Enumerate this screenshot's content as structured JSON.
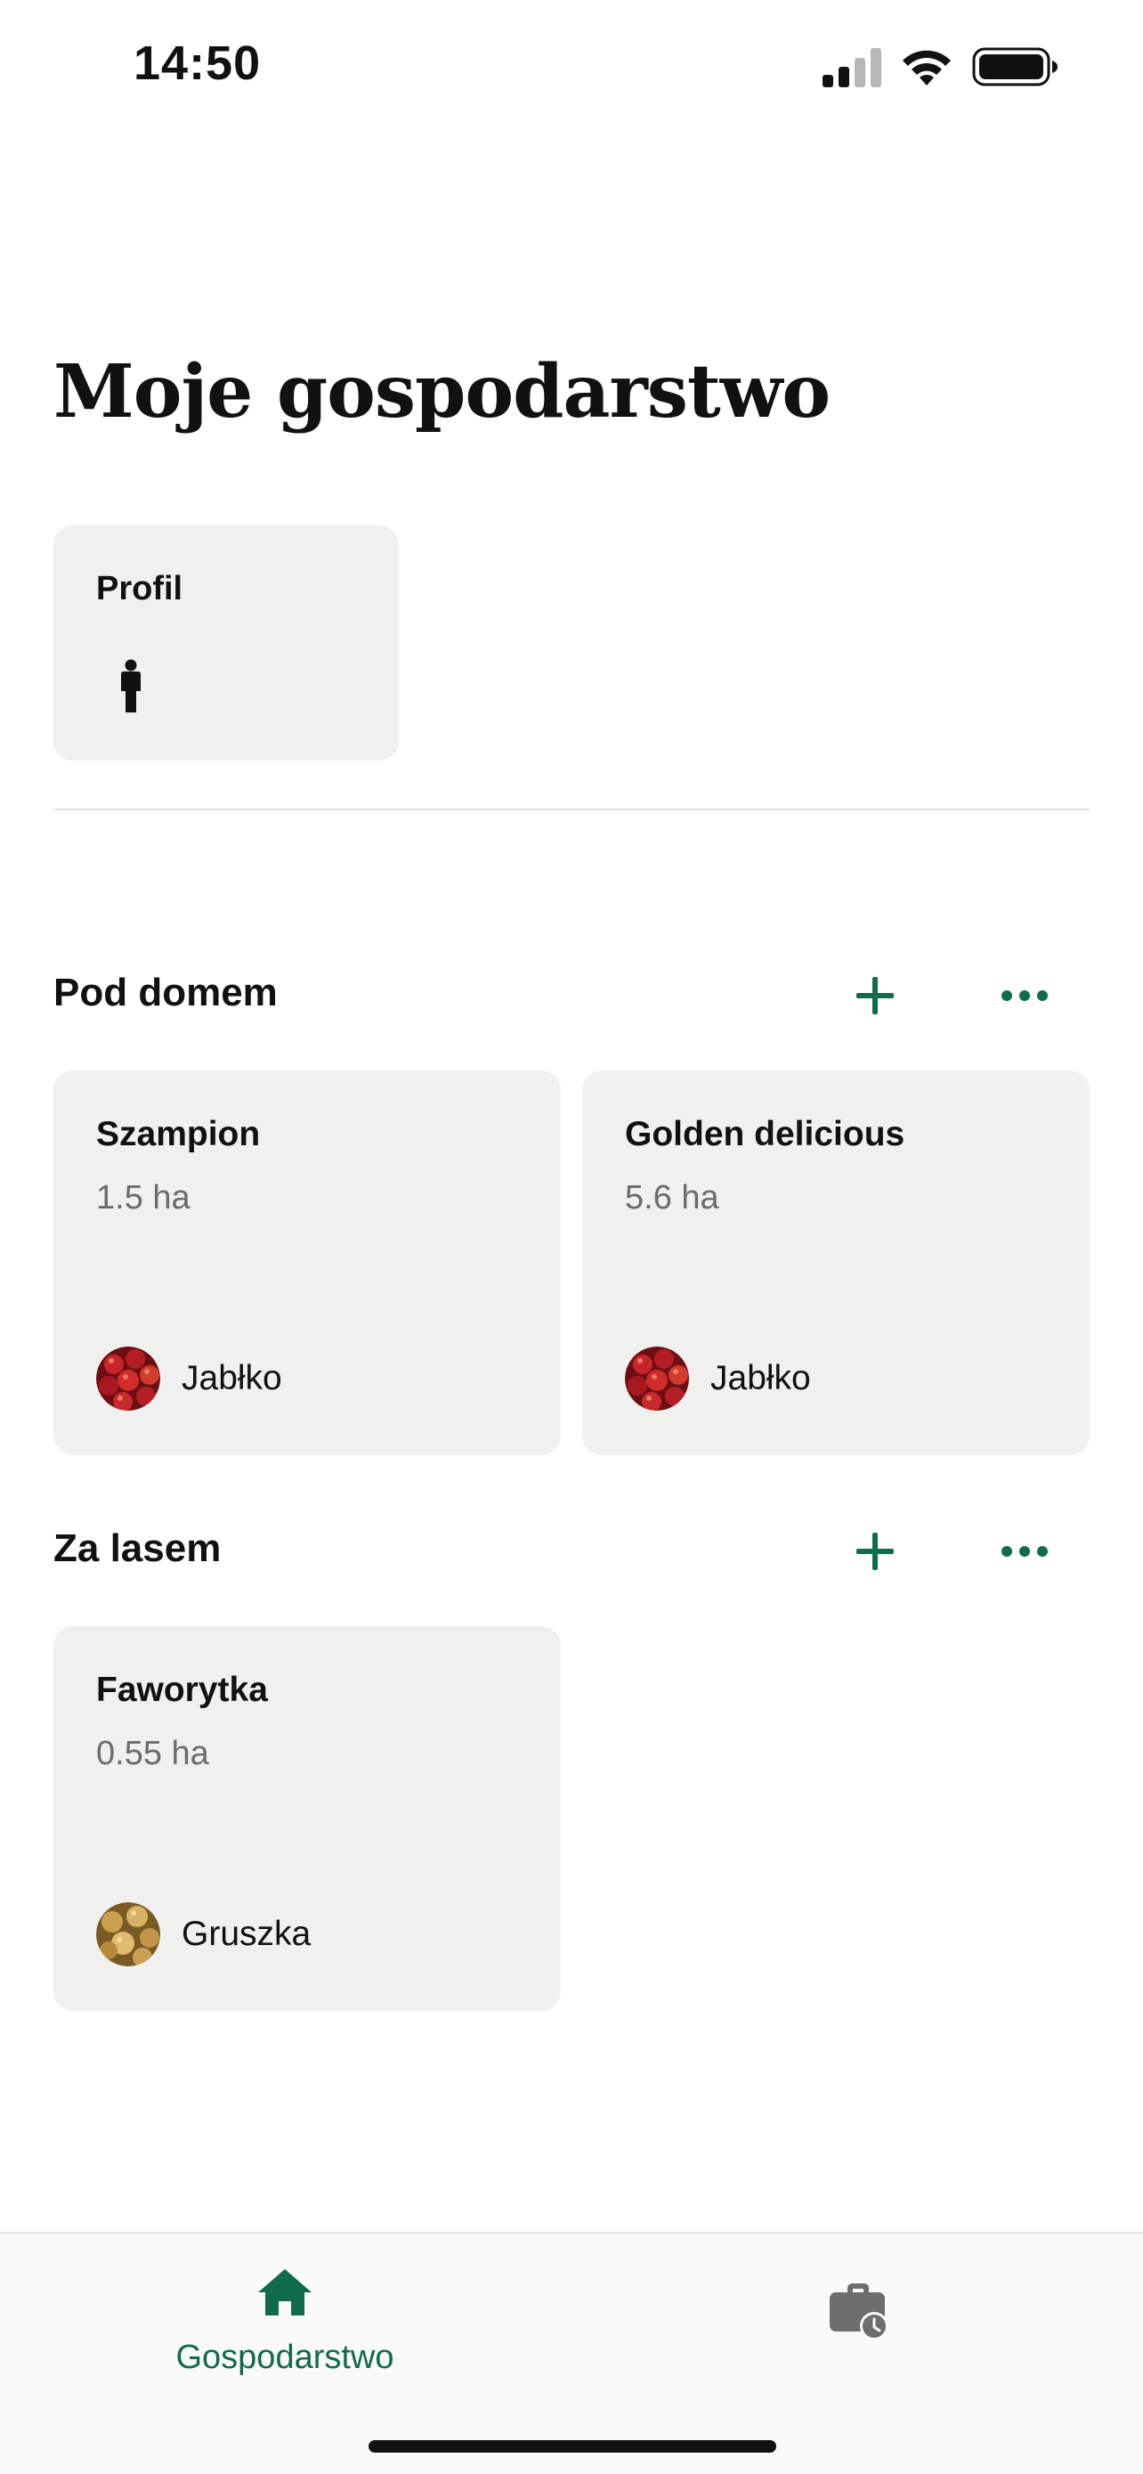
{
  "status_bar": {
    "time": "14:50"
  },
  "page": {
    "title": "Moje gospodarstwo"
  },
  "profile": {
    "label": "Profil",
    "icon": "person-icon"
  },
  "sections": [
    {
      "title": "Pod domem",
      "fields": [
        {
          "name": "Szampion",
          "area": "1.5 ha",
          "crop": "Jabłko",
          "crop_icon": "apple-photo"
        },
        {
          "name": "Golden delicious",
          "area": "5.6 ha",
          "crop": "Jabłko",
          "crop_icon": "apple-photo"
        }
      ]
    },
    {
      "title": "Za lasem",
      "fields": [
        {
          "name": "Faworytka",
          "area": "0.55 ha",
          "crop": "Gruszka",
          "crop_icon": "pear-photo"
        }
      ]
    }
  ],
  "tab_bar": {
    "tabs": [
      {
        "label": "Gospodarstwo",
        "icon": "home-icon",
        "active": true
      },
      {
        "label": "",
        "icon": "briefcase-clock-icon",
        "active": false
      }
    ]
  },
  "colors": {
    "accent": "#0f6b4b",
    "card": "#f0f0ef",
    "muted": "#6b6b6b",
    "inactive_icon": "#6e6e6e"
  }
}
